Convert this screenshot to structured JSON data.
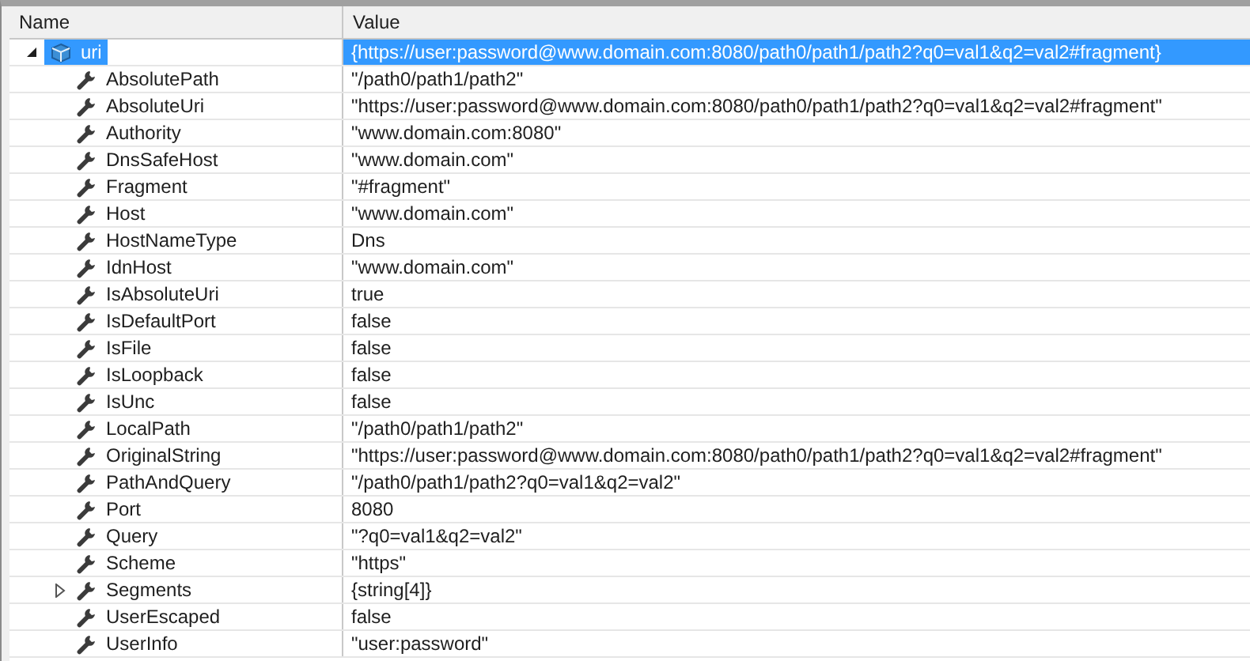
{
  "columns": [
    "Name",
    "Value"
  ],
  "root": {
    "name": "uri",
    "value": "{https://user:password@www.domain.com:8080/path0/path1/path2?q0=val1&q2=val2#fragment}",
    "expanded": true,
    "selected": true,
    "children": [
      {
        "name": "AbsolutePath",
        "value": "\"/path0/path1/path2\"",
        "selected": false
      },
      {
        "name": "AbsoluteUri",
        "value": "\"https://user:password@www.domain.com:8080/path0/path1/path2?q0=val1&q2=val2#fragment\"",
        "selected": false
      },
      {
        "name": "Authority",
        "value": "\"www.domain.com:8080\"",
        "selected": false
      },
      {
        "name": "DnsSafeHost",
        "value": "\"www.domain.com\"",
        "selected": false
      },
      {
        "name": "Fragment",
        "value": "\"#fragment\"",
        "selected": false
      },
      {
        "name": "Host",
        "value": "\"www.domain.com\"",
        "selected": false
      },
      {
        "name": "HostNameType",
        "value": "Dns",
        "selected": false
      },
      {
        "name": "IdnHost",
        "value": "\"www.domain.com\"",
        "selected": false
      },
      {
        "name": "IsAbsoluteUri",
        "value": "true",
        "selected": false
      },
      {
        "name": "IsDefaultPort",
        "value": "false",
        "selected": false
      },
      {
        "name": "IsFile",
        "value": "false",
        "selected": false
      },
      {
        "name": "IsLoopback",
        "value": "false",
        "selected": false
      },
      {
        "name": "IsUnc",
        "value": "false",
        "selected": false
      },
      {
        "name": "LocalPath",
        "value": "\"/path0/path1/path2\"",
        "selected": false
      },
      {
        "name": "OriginalString",
        "value": "\"https://user:password@www.domain.com:8080/path0/path1/path2?q0=val1&q2=val2#fragment\"",
        "selected": false
      },
      {
        "name": "PathAndQuery",
        "value": "\"/path0/path1/path2?q0=val1&q2=val2\"",
        "selected": false
      },
      {
        "name": "Port",
        "value": "8080",
        "selected": false
      },
      {
        "name": "Query",
        "value": "\"?q0=val1&q2=val2\"",
        "selected": false
      },
      {
        "name": "Scheme",
        "value": "\"https\"",
        "selected": false
      },
      {
        "name": "Segments",
        "value": "{string[4]}",
        "expanded": false,
        "selected": false
      },
      {
        "name": "UserEscaped",
        "value": "false",
        "selected": false
      },
      {
        "name": "UserInfo",
        "value": "\"user:password\"",
        "selected": false
      }
    ]
  }
}
